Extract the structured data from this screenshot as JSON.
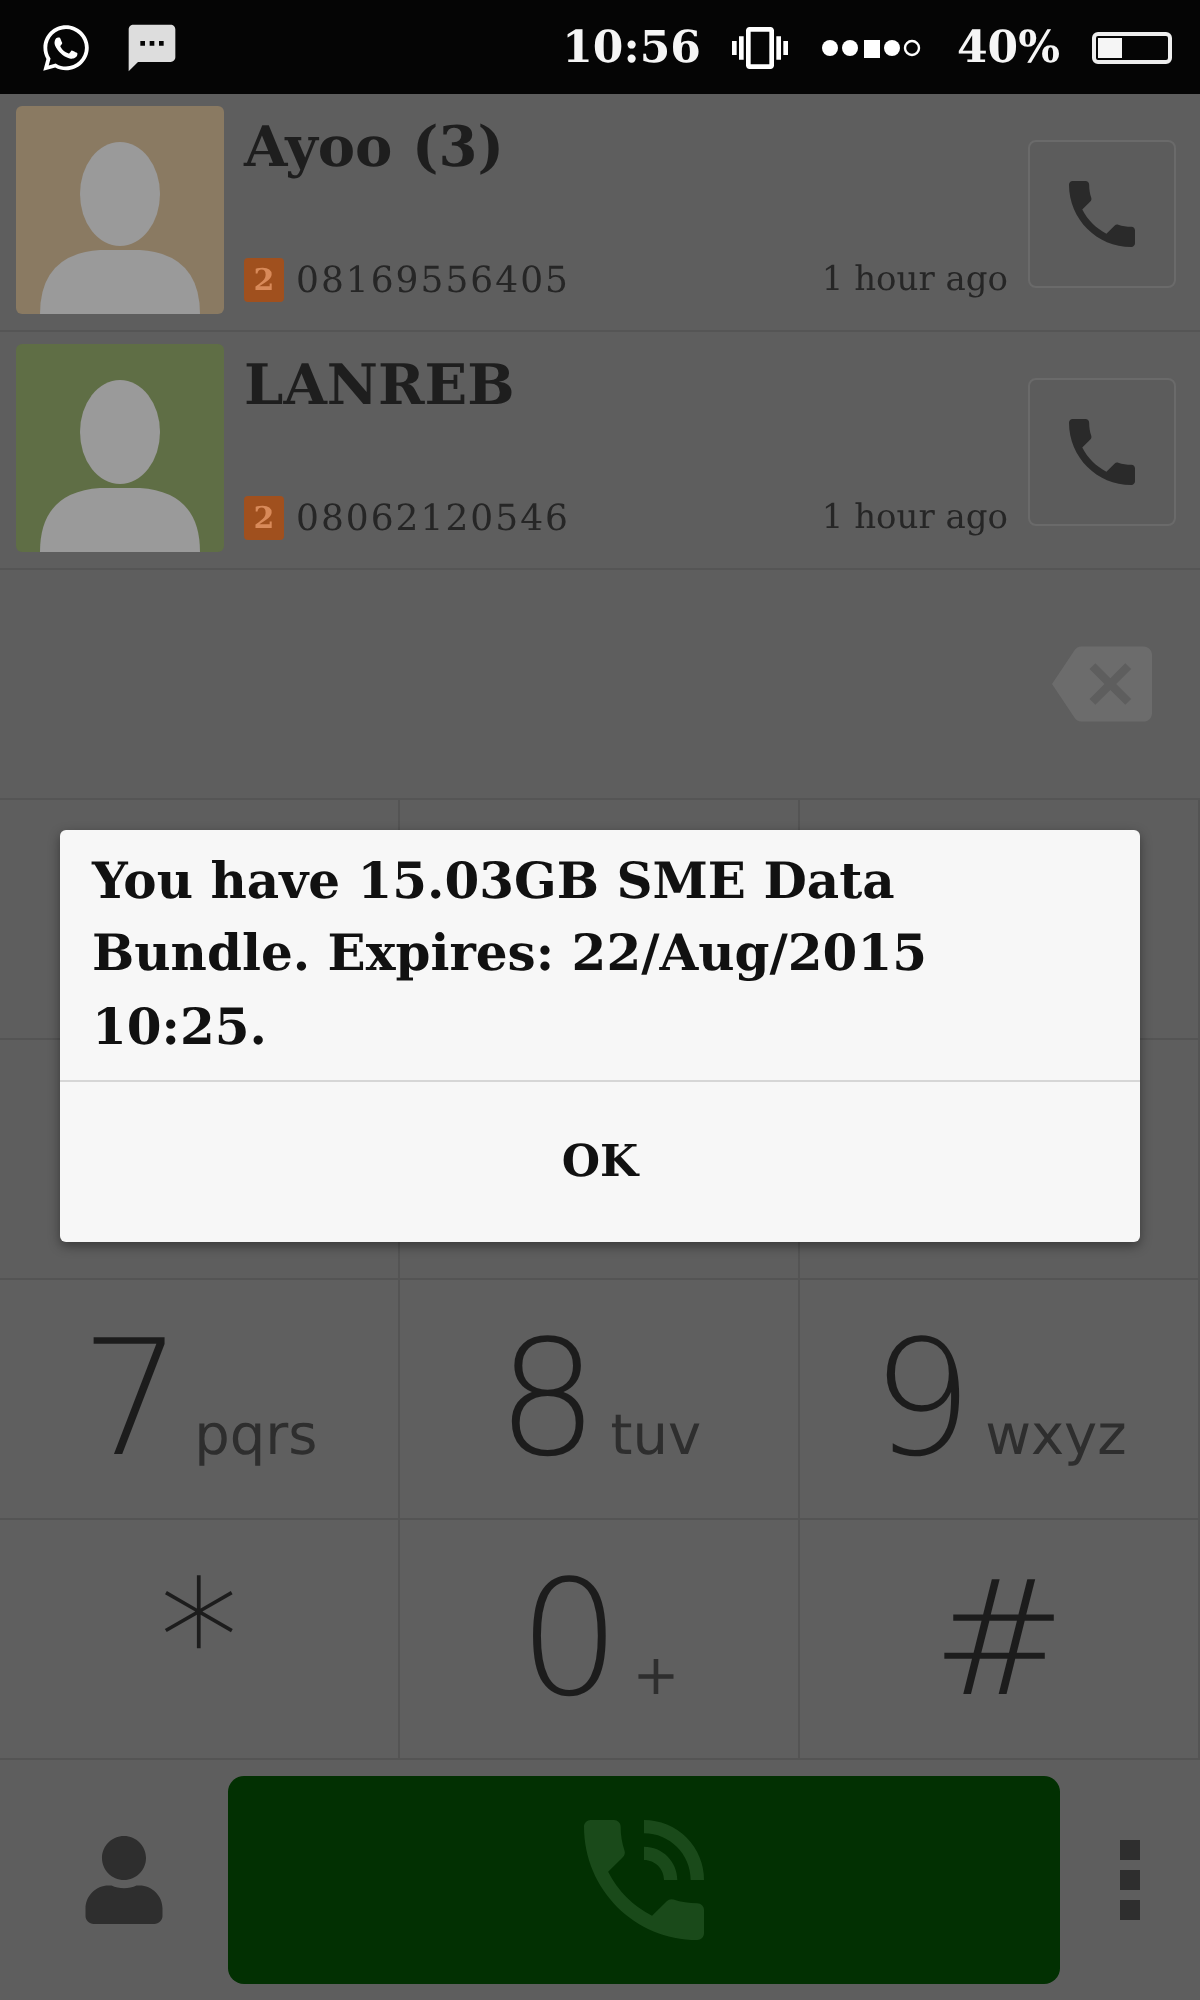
{
  "status_bar": {
    "time": "10:56",
    "battery_text": "40%",
    "battery": {
      "level": 0.35
    }
  },
  "contacts": [
    {
      "name": "Ayoo (3)",
      "sim": "2",
      "number": "08169556405",
      "time": "1 hour ago",
      "color": "#8a7a62"
    },
    {
      "name": "LANREB",
      "sim": "2",
      "number": "08062120546",
      "time": "1 hour ago",
      "color": "#5f6e45"
    }
  ],
  "keypad": [
    {
      "digit": "7",
      "letters": "pqrs"
    },
    {
      "digit": "8",
      "letters": "tuv"
    },
    {
      "digit": "9",
      "letters": "wxyz"
    },
    {
      "digit": "*"
    },
    {
      "digit": "0",
      "letters": "+"
    },
    {
      "digit": "#"
    }
  ],
  "dialog": {
    "message": "You have 15.03GB SME Data Bundle. Expires: 22/Aug/2015 10:25.",
    "button": "OK"
  }
}
